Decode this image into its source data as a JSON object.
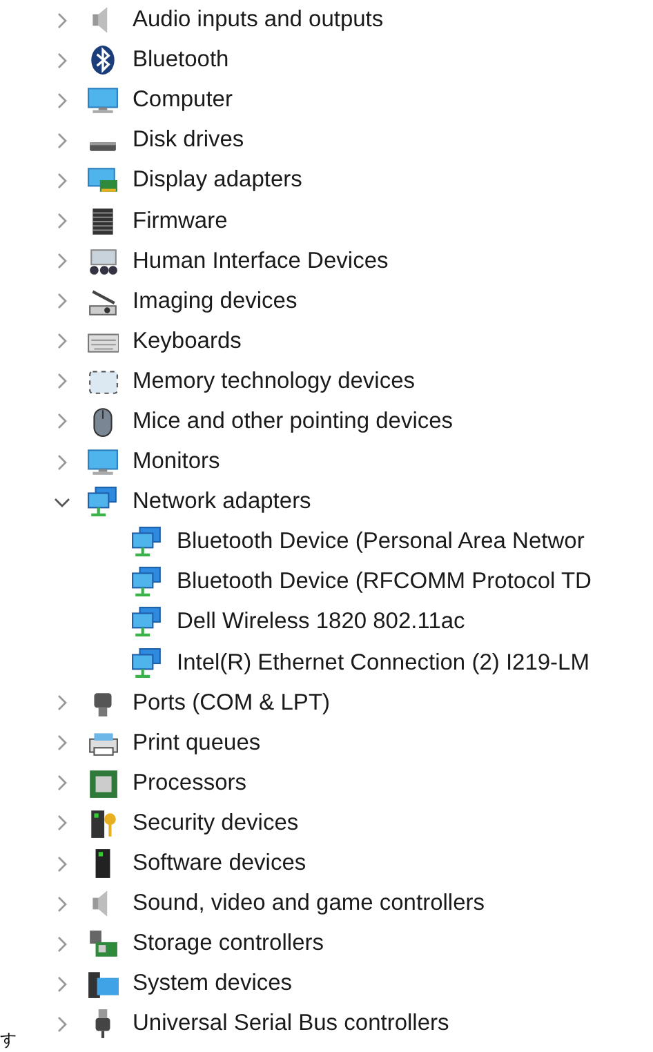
{
  "tree": [
    {
      "label": "Audio inputs and outputs",
      "expanded": false
    },
    {
      "label": "Bluetooth",
      "expanded": false
    },
    {
      "label": "Computer",
      "expanded": false
    },
    {
      "label": "Disk drives",
      "expanded": false
    },
    {
      "label": "Display adapters",
      "expanded": false
    },
    {
      "label": "Firmware",
      "expanded": false
    },
    {
      "label": "Human Interface Devices",
      "expanded": false
    },
    {
      "label": "Imaging devices",
      "expanded": false
    },
    {
      "label": "Keyboards",
      "expanded": false
    },
    {
      "label": "Memory technology devices",
      "expanded": false
    },
    {
      "label": "Mice and other pointing devices",
      "expanded": false
    },
    {
      "label": "Monitors",
      "expanded": false
    },
    {
      "label": "Network adapters",
      "expanded": true,
      "children": [
        {
          "label": "Bluetooth Device (Personal Area Networ"
        },
        {
          "label": "Bluetooth Device (RFCOMM Protocol TD"
        },
        {
          "label": "Dell Wireless 1820 802.11ac"
        },
        {
          "label": "Intel(R) Ethernet Connection (2) I219-LM"
        }
      ]
    },
    {
      "label": "Ports (COM & LPT)",
      "expanded": false
    },
    {
      "label": "Print queues",
      "expanded": false
    },
    {
      "label": "Processors",
      "expanded": false
    },
    {
      "label": "Security devices",
      "expanded": false
    },
    {
      "label": "Software devices",
      "expanded": false
    },
    {
      "label": "Sound, video and game controllers",
      "expanded": false
    },
    {
      "label": "Storage controllers",
      "expanded": false
    },
    {
      "label": "System devices",
      "expanded": false
    },
    {
      "label": "Universal Serial Bus controllers",
      "expanded": false
    }
  ],
  "stray_text": "す"
}
